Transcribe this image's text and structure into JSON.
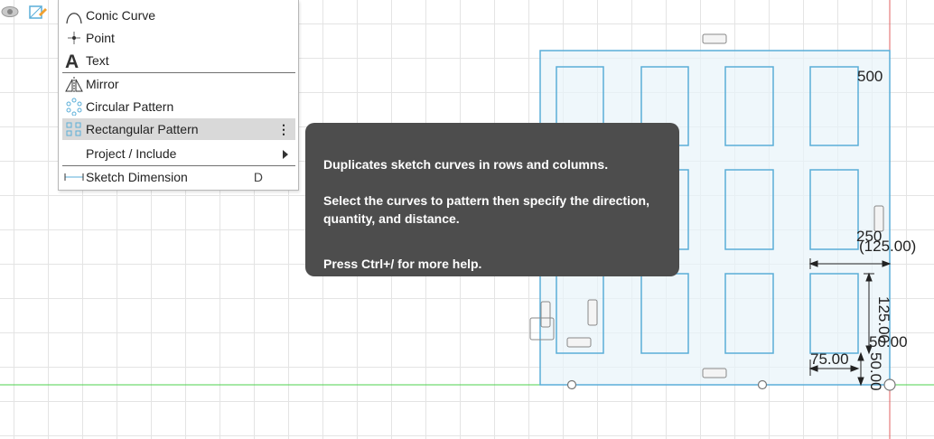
{
  "menu": {
    "items": [
      {
        "label": "Conic Curve",
        "icon": "conic-curve-icon"
      },
      {
        "label": "Point",
        "icon": "point-icon"
      },
      {
        "label": "Text",
        "icon": "text-icon"
      },
      {
        "label": "Mirror",
        "icon": "mirror-icon"
      },
      {
        "label": "Circular Pattern",
        "icon": "circular-pattern-icon"
      },
      {
        "label": "Rectangular Pattern",
        "icon": "rectangular-pattern-icon",
        "selected": true,
        "more": "⋮"
      },
      {
        "label": "Project / Include",
        "has_submenu": true
      },
      {
        "label": "Sketch Dimension",
        "icon": "sketch-dimension-icon",
        "shortcut": "D"
      }
    ]
  },
  "tooltip": {
    "line1": "Duplicates sketch curves in rows and columns.",
    "line2": "Select the curves to pattern then specify the direction, quantity, and distance.",
    "line3": "Press Ctrl+/ for more help."
  },
  "dimensions": {
    "d500": "500",
    "d250": "250",
    "d125p": "(125.00)",
    "d125": "125.00",
    "d50a": "50.00",
    "d75": "75.00",
    "d50b": "50.00"
  },
  "colors": {
    "sketch": "#5aaed8",
    "sketch_fill": "#e8f3fa",
    "axis_green": "#4cd24c",
    "axis_red": "#e06060",
    "tooltip_bg": "#4d4d4d",
    "selected_bg": "#d9d9d9"
  }
}
